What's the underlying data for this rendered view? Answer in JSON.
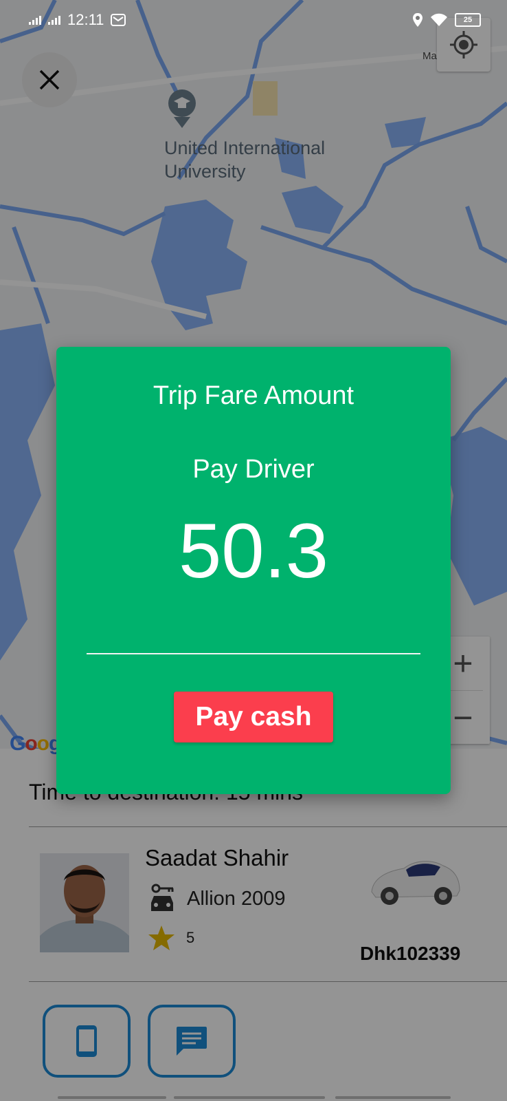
{
  "status_bar": {
    "time": "12:11",
    "battery": "25"
  },
  "map": {
    "poi_name": "United International University",
    "road_label": "Madani Ave",
    "attribution": "Google",
    "zoom_in": "+",
    "zoom_out": "−"
  },
  "dialog": {
    "title": "Trip Fare Amount",
    "subtitle": "Pay Driver",
    "amount": "50.3",
    "pay_button": "Pay cash",
    "colors": {
      "background": "#00b26d",
      "button": "#fb3e4d"
    }
  },
  "trip": {
    "eta": "Time to destination: 15 mins",
    "driver_name": "Saadat Shahir",
    "car_model": "Allion 2009",
    "rating": "5",
    "plate": "Dhk102339"
  },
  "icons": [
    "close-icon",
    "my-location-icon",
    "car-key-icon",
    "star-icon",
    "phone-icon",
    "chat-icon"
  ]
}
